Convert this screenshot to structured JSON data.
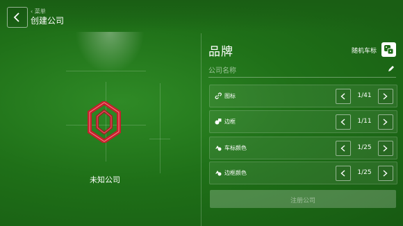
{
  "header": {
    "breadcrumb": "菜单",
    "title": "创建公司"
  },
  "preview": {
    "company_name": "未知公司",
    "logo_icon": "red-hexagon-logo"
  },
  "brand_panel": {
    "title": "品牌",
    "random_label": "随机车标",
    "name_placeholder": "公司名称",
    "rows": [
      {
        "label": "图标",
        "counter": "1/41",
        "icon": "link-icon"
      },
      {
        "label": "边框",
        "counter": "1/11",
        "icon": "shapes-icon"
      },
      {
        "label": "车标颜色",
        "counter": "1/25",
        "icon": "palette-icon"
      },
      {
        "label": "边框颜色",
        "counter": "1/25",
        "icon": "palette-icon"
      }
    ],
    "register_label": "注册公司"
  },
  "colors": {
    "background": "#1f7018",
    "logo": "#c4202c"
  }
}
